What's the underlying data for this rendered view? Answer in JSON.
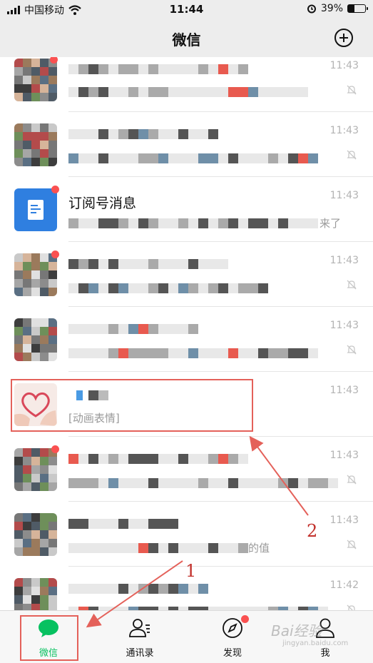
{
  "status_bar": {
    "carrier": "中国移动",
    "time": "11:44",
    "battery": "39%",
    "battery_level": 0.39
  },
  "nav": {
    "title": "微信",
    "add_icon": "plus-circle-icon"
  },
  "chats": [
    {
      "name": "",
      "preview": "",
      "time": "11:43",
      "muted": true,
      "unread_dot": true
    },
    {
      "name": "",
      "preview": "",
      "time": "11:43",
      "muted": true,
      "unread_dot": false
    },
    {
      "name": "订阅号消息",
      "preview": "来了",
      "time": "11:43",
      "muted": false,
      "unread_dot": true
    },
    {
      "name": "",
      "preview": "",
      "time": "11:43",
      "muted": true,
      "unread_dot": true
    },
    {
      "name": "",
      "preview": "",
      "time": "11:43",
      "muted": true,
      "unread_dot": false
    },
    {
      "name": "",
      "preview": "[动画表情]",
      "time": "11:43",
      "muted": false,
      "unread_dot": false
    },
    {
      "name": "",
      "preview": "",
      "time": "11:43",
      "muted": true,
      "unread_dot": true
    },
    {
      "name": "",
      "preview": "的值",
      "time": "11:43",
      "muted": true,
      "unread_dot": false
    },
    {
      "name": "",
      "preview": "",
      "time": "11:42",
      "muted": true,
      "unread_dot": false
    }
  ],
  "annotations": {
    "label_1": "1",
    "label_2": "2",
    "color": "#e4615a"
  },
  "tabs": [
    {
      "label": "微信",
      "icon": "chat-bubble-icon",
      "active": true
    },
    {
      "label": "通讯录",
      "icon": "contacts-icon",
      "active": false
    },
    {
      "label": "发现",
      "icon": "compass-icon",
      "active": false,
      "badge": true
    },
    {
      "label": "我",
      "icon": "person-icon",
      "active": false
    }
  ],
  "watermark": {
    "text": "Bai经验",
    "sub": "jingyan.baidu.com"
  },
  "colors": {
    "accent": "#07c160",
    "badge": "#fa5151",
    "subscription": "#2f7fe0"
  }
}
